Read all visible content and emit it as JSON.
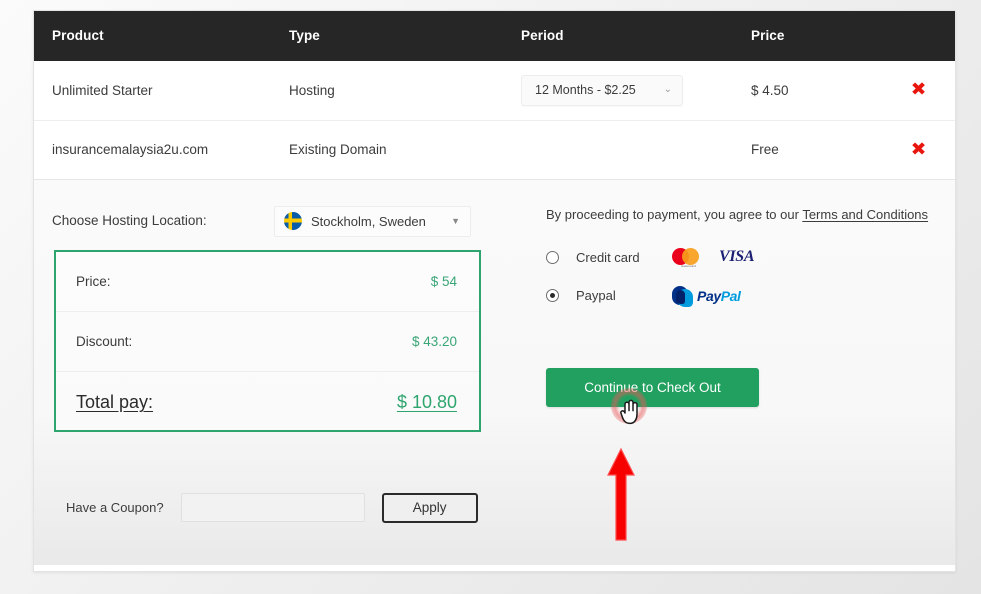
{
  "table": {
    "columns": [
      "Product",
      "Type",
      "Period",
      "Price"
    ],
    "rows": [
      {
        "product": "Unlimited Starter",
        "type": "Hosting",
        "period": "12 Months - $2.25",
        "price": "$ 4.50",
        "remove": "✖"
      },
      {
        "product": "insurancemalaysia2u.com",
        "type": "Existing Domain",
        "period": "",
        "price": "Free",
        "remove": "✖"
      }
    ]
  },
  "location": {
    "label": "Choose Hosting Location:",
    "selected": "Stockholm, Sweden",
    "flag": "sweden-flag-icon",
    "caret": "▾"
  },
  "summary": {
    "rows": [
      {
        "label": "Price:",
        "value": "$ 54"
      },
      {
        "label": "Discount:",
        "value": "$ 43.20"
      }
    ],
    "total_label": "Total pay:",
    "total_value": "$ 10.80",
    "border_color": "#2ea56f",
    "value_color": "#3aa577"
  },
  "coupon": {
    "label": "Have a Coupon?",
    "value": "",
    "placeholder": "",
    "apply_label": "Apply"
  },
  "payment": {
    "terms_prefix": "By proceeding to payment, you agree to our ",
    "terms_link": "Terms and Conditions",
    "options": [
      {
        "label": "Credit card",
        "selected": false
      },
      {
        "label": "Paypal",
        "selected": true
      }
    ],
    "mastercard_caption": "mastercard",
    "visa_label": "VISA",
    "paypal_word_1": "Pay",
    "paypal_word_2": "Pal"
  },
  "cta": {
    "label": "Continue to Check Out",
    "color": "#21a060"
  },
  "annotation": {
    "arrow_color": "#f60000",
    "cursor": "hand-pointer-cursor"
  }
}
